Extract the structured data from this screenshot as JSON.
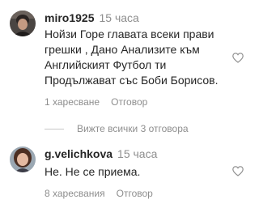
{
  "comments": [
    {
      "username": "miro1925",
      "time": "15 часа",
      "text_lines": [
        "Нойзи Горе главата всеки прави",
        "грешки , Дано Анализите към",
        "Английският Футбол ти",
        "Продължават със Боби Борисов."
      ],
      "likes": "1 харесване",
      "reply_label": "Отговор"
    },
    {
      "username": "g.velichkova",
      "time": "15 часа",
      "text_lines": [
        "Не. Не се приема."
      ],
      "likes": "8 харесвания",
      "reply_label": "Отговор"
    }
  ],
  "view_replies_label": "Вижте всички 3 отговора",
  "icons": {
    "like": "heart-outline-icon"
  },
  "colors": {
    "text": "#262626",
    "secondary": "#8e8e8e"
  }
}
